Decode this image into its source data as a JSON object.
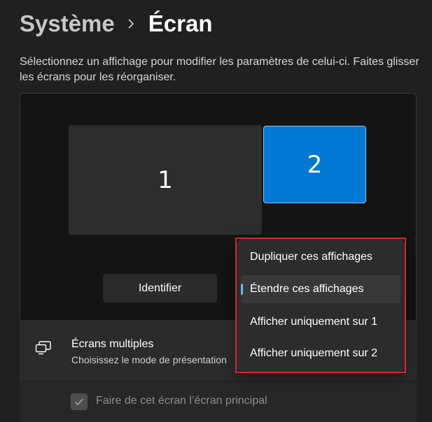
{
  "breadcrumb": {
    "parent": "Système",
    "current": "Écran"
  },
  "description": "Sélectionnez un affichage pour modifier les paramètres de celui-ci. Faites glisser les écrans pour les réorganiser.",
  "monitors": [
    {
      "label": "1"
    },
    {
      "label": "2"
    }
  ],
  "identify_label": "Identifier",
  "multiple_displays": {
    "title": "Écrans multiples",
    "subtitle": "Choisissez le mode de présentation"
  },
  "main_display_checkbox": {
    "label": "Faire de cet écran l’écran principal",
    "checked": true
  },
  "display_mode_menu": {
    "items": [
      {
        "label": "Dupliquer ces affichages"
      },
      {
        "label": "Étendre ces affichages",
        "selected": true
      },
      {
        "label": "Afficher uniquement sur 1"
      },
      {
        "label": "Afficher uniquement sur 2"
      }
    ]
  },
  "colors": {
    "accent": "#0078d4",
    "selection_indicator": "#60b8ff",
    "highlight_box": "#d9252b"
  },
  "icons": {
    "breadcrumb_separator": "chevron-right-icon",
    "multiple_displays": "multiple-displays-icon",
    "checkbox": "checkmark-icon"
  }
}
